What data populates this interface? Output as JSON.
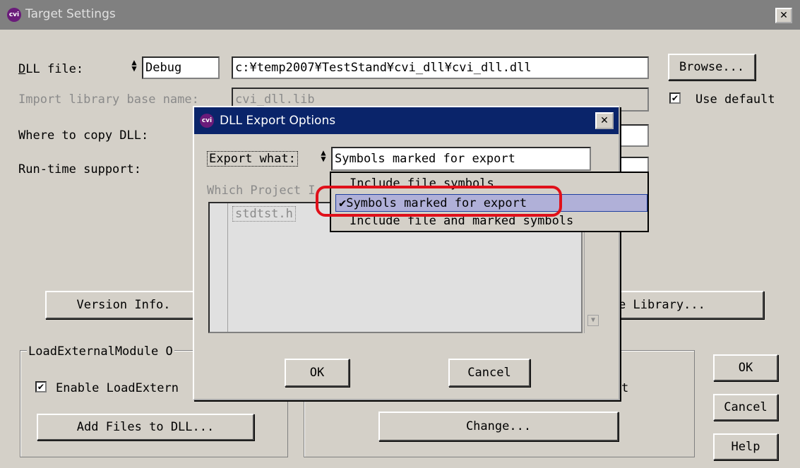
{
  "window": {
    "title": "Target Settings",
    "close_glyph": "✕",
    "logo_text": "cvi"
  },
  "main": {
    "dll_file_label": "DLL file:",
    "dll_config": "Debug",
    "dll_path": "c:¥temp2007¥TestStand¥cvi_dll¥cvi_dll.dll",
    "browse_label": "Browse...",
    "import_lib_label": "Import library base name:",
    "import_lib_value": "cvi_dll.lib",
    "use_default_label": "Use default",
    "use_default_checked": "✔",
    "where_copy_label": "Where to copy DLL:",
    "runtime_label": "Run-time support:",
    "version_info_label": "Version Info.",
    "import_library_label": "e Library...",
    "load_group_label": "LoadExternalModule O",
    "enable_load_label": "Enable LoadExtern",
    "enable_checked": "✔",
    "add_files_label": "Add Files to DLL...",
    "partial_t": "t",
    "change_label": "Change...",
    "ok_label": "OK",
    "cancel_label": "Cancel",
    "help_label": "Help"
  },
  "dialog": {
    "title": "DLL Export Options",
    "close_glyph": "✕",
    "export_what_label": "Export what:",
    "export_what_value": "Symbols marked for export",
    "which_project_label": "Which Project I",
    "list_items": [
      "stdtst.h"
    ],
    "ok_label": "OK",
    "cancel_label": "Cancel"
  },
  "dropdown": {
    "options": [
      {
        "label": "Include file symbols",
        "selected": false
      },
      {
        "label": "Symbols marked for export",
        "selected": true
      },
      {
        "label": "Include file and marked symbols",
        "selected": false
      }
    ],
    "check_glyph": "✔"
  },
  "colors": {
    "highlight": "#e0101a",
    "dialog_title_bg": "#0a246a",
    "selection_bg": "#b0b0d8"
  }
}
